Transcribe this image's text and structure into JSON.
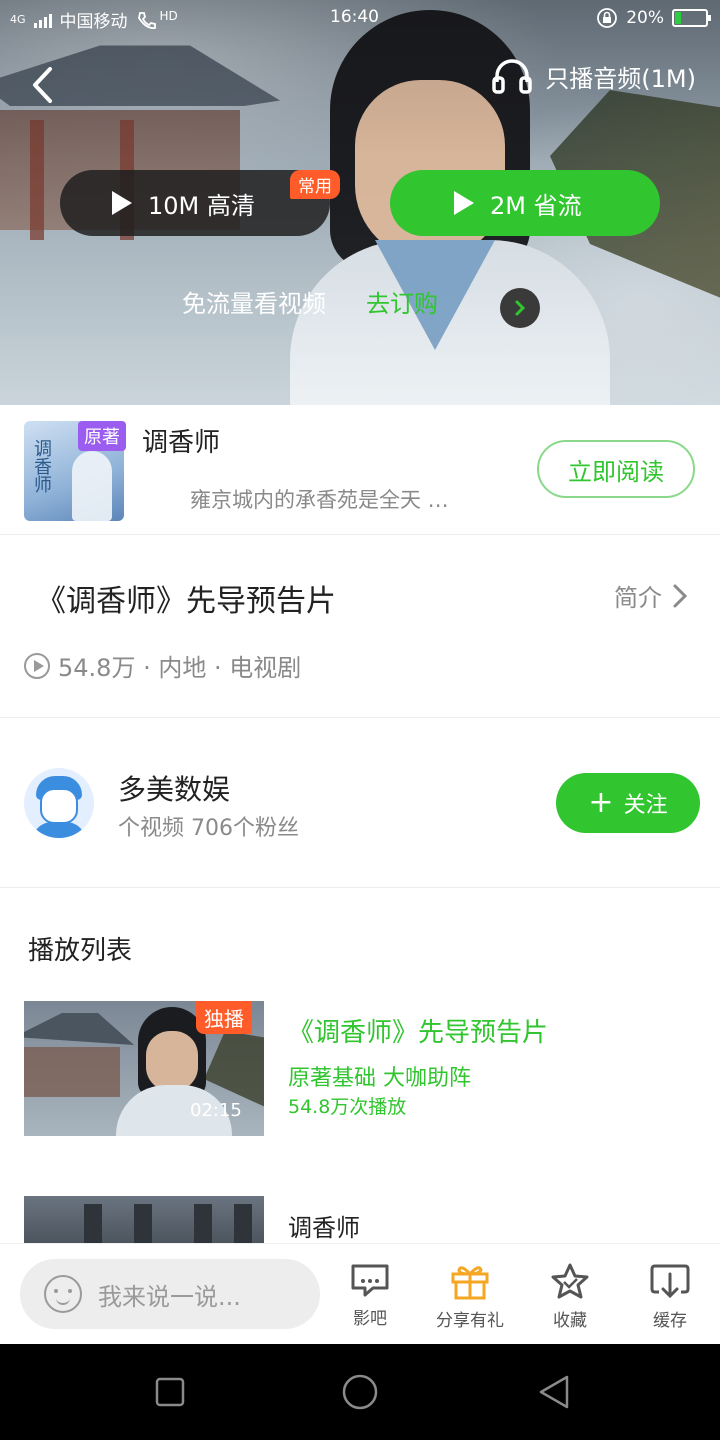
{
  "status_bar": {
    "network": "4G",
    "carrier": "中国移动",
    "hd_label": "HD",
    "time": "16:40",
    "battery": "20%",
    "battery_level": 0.2
  },
  "player": {
    "audio_only_label": "只播音频(1M)",
    "quality_hd": "10M 高清",
    "quality_hd_badge": "常用",
    "quality_save": "2M 省流",
    "free_data_text": "免流量看视频",
    "free_data_link": "去订购"
  },
  "novel": {
    "cover_text": "调香师",
    "badge": "原著",
    "title": "调香师",
    "description": "雍京城内的承香苑是全天 …",
    "read_button": "立即阅读"
  },
  "video": {
    "title": "《调香师》先导预告片",
    "intro_link": "简介",
    "meta": "54.8万 · 内地 · 电视剧"
  },
  "uploader": {
    "name": "多美数娱",
    "stats": "个视频 706个粉丝",
    "follow_button": "关注"
  },
  "playlist": {
    "heading": "播放列表",
    "items": [
      {
        "badge": "独播",
        "duration": "02:15",
        "title": "《调香师》先导预告片",
        "subtitle": "原著基础 大咖助阵",
        "plays": "54.8万次播放"
      },
      {
        "title": "调香师"
      }
    ]
  },
  "bottom_bar": {
    "comment_placeholder": "我来说一说...",
    "tabs": [
      {
        "label": "影吧",
        "icon": "chat-bubble-icon"
      },
      {
        "label": "分享有礼",
        "icon": "gift-icon"
      },
      {
        "label": "收藏",
        "icon": "star-icon"
      },
      {
        "label": "缓存",
        "icon": "download-icon"
      }
    ]
  },
  "colors": {
    "accent_green": "#31c52f",
    "badge_orange": "#ff5c2a",
    "badge_purple": "#9b5cf0"
  }
}
